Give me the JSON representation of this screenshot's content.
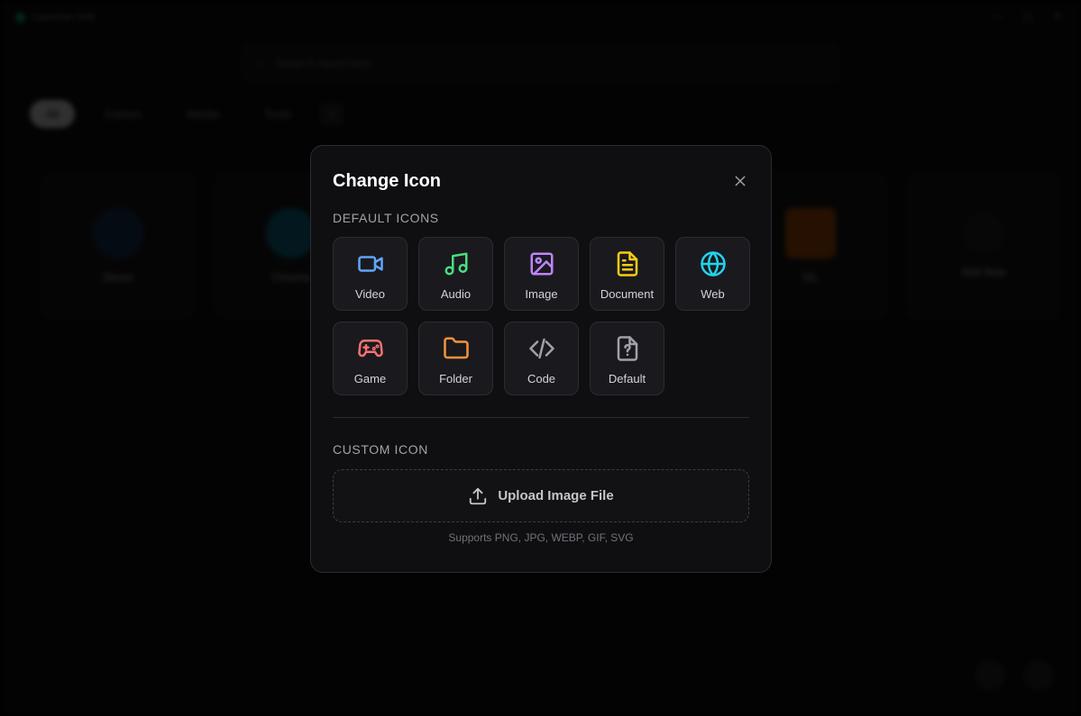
{
  "background": {
    "app_name": "Launcher Hub",
    "search_placeholder": "Search launches...",
    "tabs": [
      "All",
      "Games",
      "Media",
      "Tools"
    ],
    "tab_add": "+",
    "cards": [
      {
        "label": "Steam",
        "color": "#1e3a5f"
      },
      {
        "label": "Chrome",
        "color": "#0e7490"
      },
      {
        "label": "",
        "color": "#1c1c20"
      },
      {
        "label": "",
        "color": "#1c1c20"
      },
      {
        "label": "ISL",
        "color": "#b45309"
      },
      {
        "label": "Add New",
        "color": "#27272a"
      }
    ]
  },
  "modal": {
    "title": "Change Icon",
    "close_label": "×",
    "default_section_label": "DEFAULT ICONS",
    "icons": [
      {
        "label": "Video",
        "icon": "video-icon",
        "color": "#60a5fa"
      },
      {
        "label": "Audio",
        "icon": "music-icon",
        "color": "#4ade80"
      },
      {
        "label": "Image",
        "icon": "image-icon",
        "color": "#c084fc"
      },
      {
        "label": "Document",
        "icon": "document-icon",
        "color": "#facc15"
      },
      {
        "label": "Web",
        "icon": "globe-icon",
        "color": "#22d3ee"
      },
      {
        "label": "Game",
        "icon": "gamepad-icon",
        "color": "#f87171"
      },
      {
        "label": "Folder",
        "icon": "folder-icon",
        "color": "#fb923c"
      },
      {
        "label": "Code",
        "icon": "code-icon",
        "color": "#a1a1aa"
      },
      {
        "label": "Default",
        "icon": "file-question-icon",
        "color": "#a1a1aa"
      }
    ],
    "custom_section_label": "CUSTOM ICON",
    "upload_label": "Upload Image File",
    "support_text": "Supports PNG, JPG, WEBP, GIF, SVG"
  }
}
